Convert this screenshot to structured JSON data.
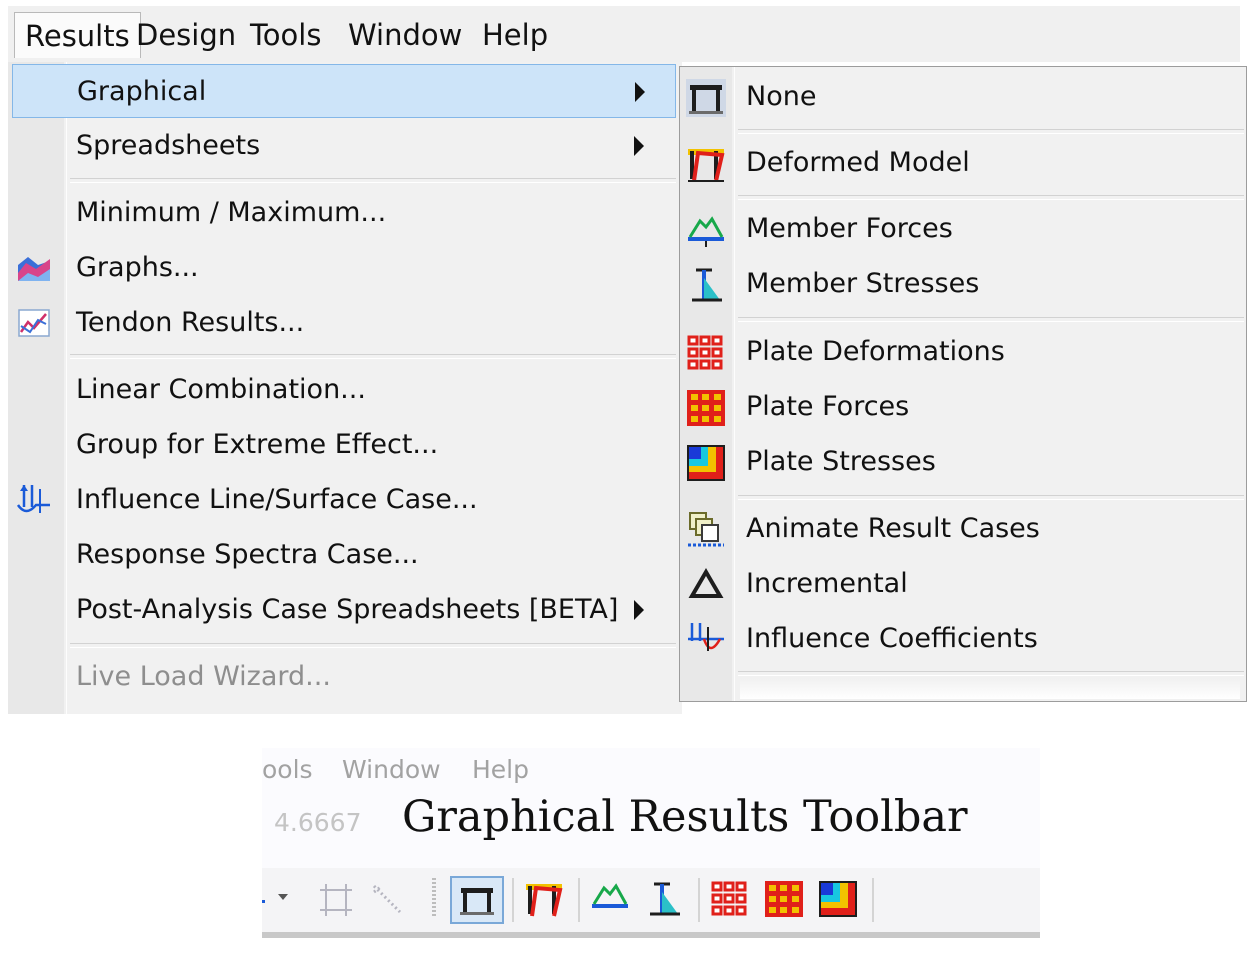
{
  "menubar": {
    "items": [
      {
        "label": "Results",
        "active": true
      },
      {
        "label": "Design"
      },
      {
        "label": "Tools"
      },
      {
        "label": "Window"
      },
      {
        "label": "Help"
      }
    ]
  },
  "results_menu": {
    "items": [
      {
        "label": "Graphical",
        "highlighted": true,
        "submenu": true
      },
      {
        "label": "Spreadsheets",
        "submenu": true
      },
      {
        "label": "Minimum / Maximum..."
      },
      {
        "label": "Graphs...",
        "icon": "graphs-icon"
      },
      {
        "label": "Tendon Results...",
        "icon": "tendon-results-icon"
      },
      {
        "label": "Linear Combination..."
      },
      {
        "label": "Group for Extreme Effect..."
      },
      {
        "label": "Influence Line/Surface Case...",
        "icon": "influence-line-icon"
      },
      {
        "label": "Response Spectra Case..."
      },
      {
        "label": "Post-Analysis Case Spreadsheets [BETA]",
        "submenu": true
      },
      {
        "label": "Live Load Wizard...",
        "disabled": true
      }
    ]
  },
  "graphical_submenu": {
    "items": [
      {
        "label": "None",
        "icon": "frame-none-icon"
      },
      {
        "label": "Deformed Model",
        "icon": "deformed-model-icon"
      },
      {
        "label": "Member Forces",
        "icon": "member-forces-icon"
      },
      {
        "label": "Member Stresses",
        "icon": "member-stresses-icon"
      },
      {
        "label": "Plate Deformations",
        "icon": "plate-deformations-icon"
      },
      {
        "label": "Plate Forces",
        "icon": "plate-forces-icon"
      },
      {
        "label": "Plate Stresses",
        "icon": "plate-stresses-icon"
      },
      {
        "label": "Animate Result Cases",
        "icon": "animate-result-cases-icon"
      },
      {
        "label": "Incremental",
        "icon": "incremental-triangle-icon"
      },
      {
        "label": "Influence Coefficients",
        "icon": "influence-coefficients-icon"
      }
    ]
  },
  "toolbar_panel": {
    "menu": [
      "ools",
      "Window",
      "Help"
    ],
    "coordinate": "4.6667",
    "title": "Graphical Results Toolbar",
    "buttons": [
      "dropdown-arrow-icon",
      "zoom-frame-icon",
      "dotted-line-icon",
      "frame-none-icon",
      "deformed-model-icon",
      "member-forces-icon",
      "member-stresses-icon",
      "plate-deformations-icon",
      "plate-forces-icon",
      "plate-stresses-icon"
    ],
    "selected_button": "frame-none-icon"
  },
  "colors": {
    "highlight_bg": "#cde4f9",
    "highlight_border": "#84b7e8",
    "menu_bg": "#f1f1f1",
    "disabled_text": "#8e8e8e"
  }
}
